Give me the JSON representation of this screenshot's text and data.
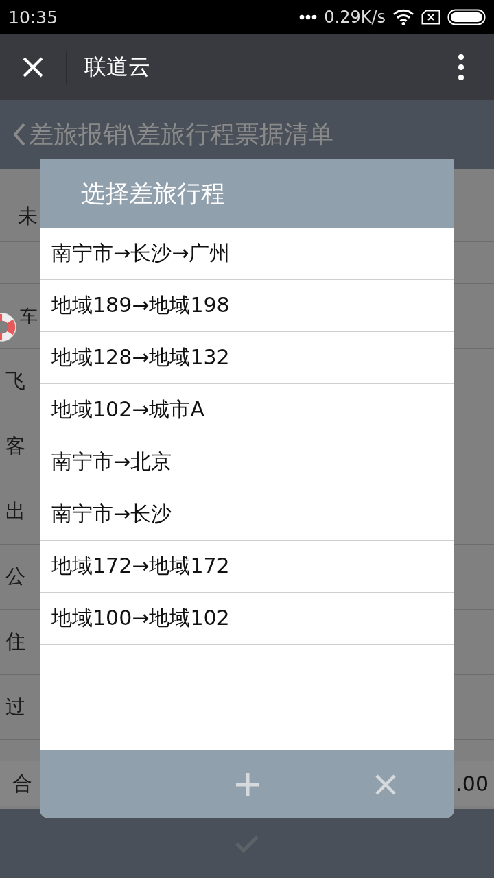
{
  "status_bar": {
    "time": "10:35",
    "speed": "0.29K/s"
  },
  "nav": {
    "title": "联道云"
  },
  "breadcrumb": "差旅报销\\差旅行程票据清单",
  "background": {
    "header_label": "未",
    "rows": [
      "车",
      "飞",
      "客",
      "出",
      "公",
      "住",
      "过"
    ],
    "total_label": "合",
    "total_value": ".00"
  },
  "dialog": {
    "title": "选择差旅行程",
    "items": [
      {
        "label": "南宁市→长沙→广州"
      },
      {
        "label": "地域189→地域198"
      },
      {
        "label": "地域128→地域132"
      },
      {
        "label": "地域102→城市A"
      },
      {
        "label": "南宁市→北京"
      },
      {
        "label": "南宁市→长沙"
      },
      {
        "label": "地域172→地域172"
      },
      {
        "label": "地域100→地域102"
      }
    ]
  }
}
